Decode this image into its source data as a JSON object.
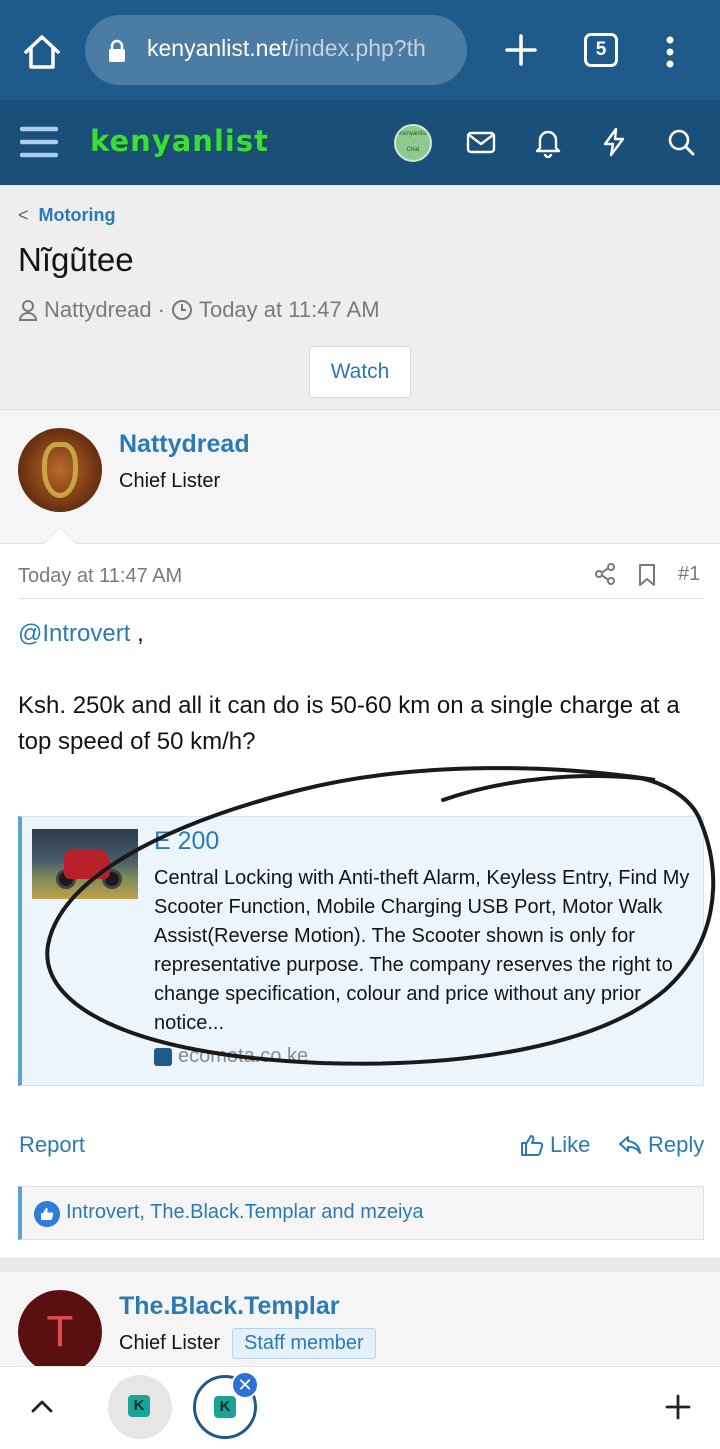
{
  "browser": {
    "url_host": "kenyanlist.net",
    "url_path": "/index.php?th",
    "tab_count": "5"
  },
  "site": {
    "logo_text": "kenyanlist",
    "avatar_text": "Kenyanlist Chat"
  },
  "thread": {
    "breadcrumb": "Motoring",
    "title": "Nĩgũtee",
    "author": "Nattydread",
    "separator": "·",
    "time": "Today at 11:47 AM",
    "watch_label": "Watch"
  },
  "post1": {
    "username": "Nattydread",
    "user_title": "Chief Lister",
    "date": "Today at 11:47 AM",
    "post_number": "#1",
    "mention": "@Introvert",
    "mention_suffix": " ,",
    "body": "Ksh. 250k and all it can do is 50-60 km on a single charge at a top speed of 50 km/h?",
    "unfurl": {
      "title": "E 200",
      "description": "Central Locking with Anti-theft Alarm, Keyless Entry, Find My Scooter Function, Mobile Charging USB Port, Motor Walk Assist(Reverse Motion). The Scooter shown is only for representative purpose. The company reserves the right to change specification, colour and price without any prior notice...",
      "source": "ecomota.co.ke"
    },
    "report_label": "Report",
    "like_label": "Like",
    "reply_label": "Reply",
    "reactions_text": "Introvert, The.Black.Templar and mzeiya"
  },
  "post2": {
    "username": "The.Black.Templar",
    "avatar_letter": "T",
    "user_title": "Chief Lister",
    "badge": "Staff member"
  },
  "bottom_tabs": {
    "tab_letter": "K",
    "close_symbol": "✕"
  },
  "colors": {
    "browser_bar": "#1e5a8a",
    "site_bar": "#1a4f7a",
    "link": "#2c7ab5",
    "logo": "#3ddc3d"
  },
  "icons": [
    "home-icon",
    "lock-icon",
    "plus-icon",
    "tab-count-icon",
    "more-icon",
    "menu-icon",
    "inbox-icon",
    "bell-icon",
    "bolt-icon",
    "search-icon",
    "user-icon",
    "clock-icon",
    "share-icon",
    "bookmark-icon",
    "thumbs-up-icon",
    "reply-icon",
    "like-badge-icon",
    "caret-up-icon",
    "close-icon",
    "new-tab-icon"
  ]
}
